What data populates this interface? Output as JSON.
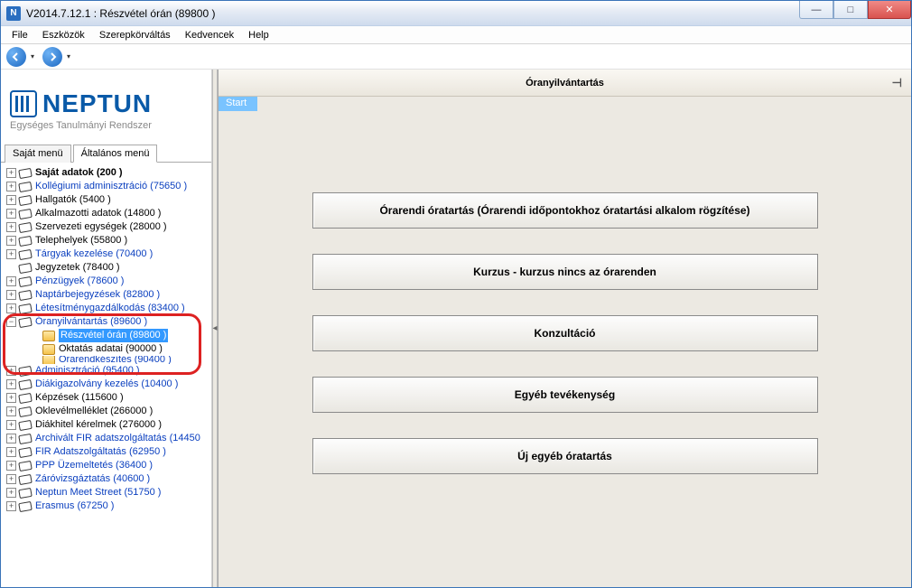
{
  "window": {
    "title": "V2014.7.12.1 : Részvétel órán (89800  )"
  },
  "menu": {
    "file": "File",
    "tools": "Eszközök",
    "roleswitch": "Szerepkörváltás",
    "favorites": "Kedvencek",
    "help": "Help"
  },
  "logo": {
    "brand": "NEPTUN",
    "tagline": "Egységes Tanulmányi Rendszer"
  },
  "tabs": {
    "own": "Saját menü",
    "general": "Általános menü"
  },
  "tree": {
    "n0": "Saját adatok (200  )",
    "n1": "Kollégiumi adminisztráció (75650  )",
    "n2": "Hallgatók (5400  )",
    "n3": "Alkalmazotti adatok (14800  )",
    "n4": "Szervezeti egységek (28000  )",
    "n5": "Telephelyek (55800  )",
    "n6": "Tárgyak kezelése (70400  )",
    "n7": "Jegyzetek (78400  )",
    "n8": "Pénzügyek (78600  )",
    "n9": "Naptárbejegyzések (82800  )",
    "n10": "Létesítménygazdálkodás (83400  )",
    "n11": "Óranyilvántartás (89600  )",
    "n11a": "Részvétel órán (89800  )",
    "n11b": "Oktatás adatai (90000  )",
    "n11c": "Órarendkészítés (90400  )",
    "n12": "Adminisztráció (95400  )",
    "n13": "Diákigazolvány kezelés (10400  )",
    "n14": "Képzések (115600  )",
    "n15": "Oklevélmelléklet (266000  )",
    "n16": "Diákhitel kérelmek (276000  )",
    "n17": "Archivált FIR adatszolgáltatás (14450",
    "n18": "FIR Adatszolgáltatás (62950  )",
    "n19": "PPP Üzemeltetés (36400  )",
    "n20": "Záróvizsgáztatás (40600  )",
    "n21": "Neptun Meet Street (51750  )",
    "n22": "Erasmus (67250  )"
  },
  "main": {
    "header": "Óranyilvántartás",
    "breadcrumb": "Start",
    "buttons": {
      "b1": "Órarendi óratartás (Órarendi időpontokhoz óratartási alkalom rögzítése)",
      "b2": "Kurzus - kurzus nincs az órarenden",
      "b3": "Konzultáció",
      "b4": "Egyéb tevékenység",
      "b5": "Új egyéb óratartás"
    }
  }
}
